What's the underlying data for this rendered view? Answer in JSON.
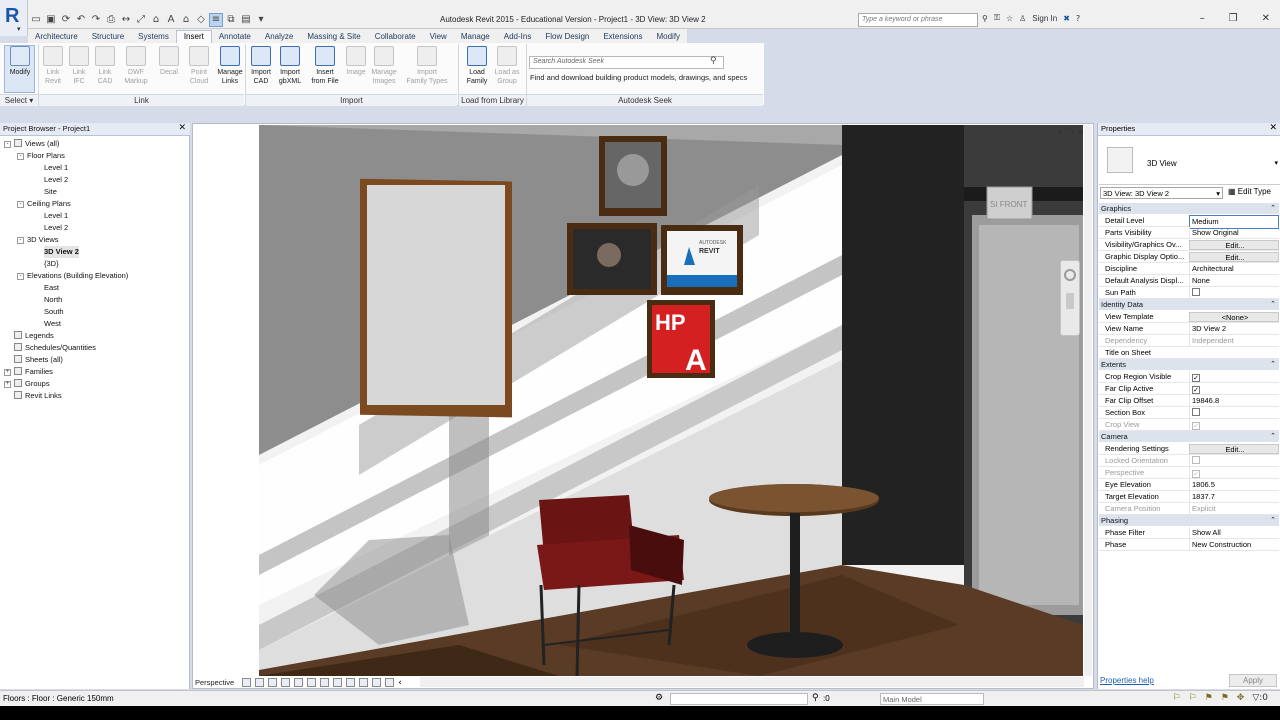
{
  "title_bar": {
    "title": "Autodesk Revit 2015 - Educational Version -    Project1 - 3D View: 3D View 2",
    "search_placeholder": "Type a keyword or phrase",
    "sign_in": "Sign In",
    "app_letter": "R"
  },
  "ribbon": {
    "tabs": [
      "Architecture",
      "Structure",
      "Systems",
      "Insert",
      "Annotate",
      "Analyze",
      "Massing & Site",
      "Collaborate",
      "View",
      "Manage",
      "Add-Ins",
      "Flow Design",
      "Extensions",
      "Modify"
    ],
    "active_tab": "Insert",
    "modify": "Modify",
    "select": "Select",
    "link_buttons": [
      {
        "line1": "Link",
        "line2": "Revit"
      },
      {
        "line1": "Link",
        "line2": "IFC"
      },
      {
        "line1": "Link",
        "line2": "CAD"
      },
      {
        "line1": "DWF",
        "line2": "Markup"
      },
      {
        "line1": "Decal",
        "line2": ""
      },
      {
        "line1": "Point",
        "line2": "Cloud"
      },
      {
        "line1": "Manage",
        "line2": "Links"
      }
    ],
    "import_buttons": [
      {
        "line1": "Import",
        "line2": "CAD"
      },
      {
        "line1": "Import",
        "line2": "gbXML"
      },
      {
        "line1": "Insert",
        "line2": "from File"
      },
      {
        "line1": "Image",
        "line2": ""
      },
      {
        "line1": "Manage",
        "line2": "Images"
      },
      {
        "line1": "Import",
        "line2": "Family Types"
      }
    ],
    "library_buttons": [
      {
        "line1": "Load",
        "line2": "Family"
      },
      {
        "line1": "Load as",
        "line2": "Group"
      }
    ],
    "groups": {
      "link": "Link",
      "import": "Import",
      "library": "Load from Library",
      "seek": "Autodesk Seek"
    },
    "seek_placeholder": "Search Autodesk Seek",
    "seek_description": "Find and download building product models, drawings, and specs"
  },
  "project_browser": {
    "title": "Project Browser - Project1",
    "tree": [
      {
        "label": "Views (all)",
        "level": 0,
        "exp": "-"
      },
      {
        "label": "Floor Plans",
        "level": 1,
        "exp": "-"
      },
      {
        "label": "Level 1",
        "level": 2
      },
      {
        "label": "Level 2",
        "level": 2
      },
      {
        "label": "Site",
        "level": 2
      },
      {
        "label": "Ceiling Plans",
        "level": 1,
        "exp": "-"
      },
      {
        "label": "Level 1",
        "level": 2
      },
      {
        "label": "Level 2",
        "level": 2
      },
      {
        "label": "3D Views",
        "level": 1,
        "exp": "-"
      },
      {
        "label": "3D View 2",
        "level": 2,
        "selected": true
      },
      {
        "label": "{3D}",
        "level": 2
      },
      {
        "label": "Elevations (Building Elevation)",
        "level": 1,
        "exp": "-"
      },
      {
        "label": "East",
        "level": 2
      },
      {
        "label": "North",
        "level": 2
      },
      {
        "label": "South",
        "level": 2
      },
      {
        "label": "West",
        "level": 2
      },
      {
        "label": "Legends",
        "level": 0
      },
      {
        "label": "Schedules/Quantities",
        "level": 0
      },
      {
        "label": "Sheets (all)",
        "level": 0
      },
      {
        "label": "Families",
        "level": 0,
        "exp": "+"
      },
      {
        "label": "Groups",
        "level": 0,
        "exp": "+"
      },
      {
        "label": "Revit Links",
        "level": 0
      }
    ]
  },
  "viewport": {
    "scale_label": "Perspective",
    "poster_revit": "REVIT",
    "poster_autodesk": "AUTODESK",
    "poster_hp": "HP",
    "poster_a": "A",
    "sign_text": "SI FRONT"
  },
  "properties": {
    "title": "Properties",
    "type_name": "3D View",
    "instance": "3D View: 3D View 2",
    "edit_type": "Edit Type",
    "groups": [
      {
        "name": "Graphics",
        "rows": [
          {
            "k": "Detail Level",
            "v": "Medium",
            "style": "sel"
          },
          {
            "k": "Parts Visibility",
            "v": "Show Original"
          },
          {
            "k": "Visibility/Graphics Ov...",
            "v": "Edit...",
            "style": "btn"
          },
          {
            "k": "Graphic Display Optio...",
            "v": "Edit...",
            "style": "btn"
          },
          {
            "k": "Discipline",
            "v": "Architectural"
          },
          {
            "k": "Default Analysis Displ...",
            "v": "None"
          },
          {
            "k": "Sun Path",
            "v": "",
            "cb": "off"
          }
        ]
      },
      {
        "name": "Identity Data",
        "rows": [
          {
            "k": "View Template",
            "v": "<None>",
            "style": "btn"
          },
          {
            "k": "View Name",
            "v": "3D View 2"
          },
          {
            "k": "Dependency",
            "v": "Independent",
            "dim": true
          },
          {
            "k": "Title on Sheet",
            "v": ""
          }
        ]
      },
      {
        "name": "Extents",
        "rows": [
          {
            "k": "Crop Region Visible",
            "v": "",
            "cb": "on"
          },
          {
            "k": "Far Clip Active",
            "v": "",
            "cb": "on"
          },
          {
            "k": "Far Clip Offset",
            "v": "19846.8"
          },
          {
            "k": "Section Box",
            "v": "",
            "cb": "off"
          },
          {
            "k": "Crop View",
            "v": "",
            "cb": "dim",
            "dim": true
          }
        ]
      },
      {
        "name": "Camera",
        "rows": [
          {
            "k": "Rendering Settings",
            "v": "Edit...",
            "style": "btn"
          },
          {
            "k": "Locked Orientation",
            "v": "",
            "cb": "dimoff",
            "dim": true
          },
          {
            "k": "Perspective",
            "v": "",
            "cb": "dim",
            "dim": true
          },
          {
            "k": "Eye Elevation",
            "v": "1806.5"
          },
          {
            "k": "Target Elevation",
            "v": "1837.7"
          },
          {
            "k": "Camera Position",
            "v": "Explicit",
            "dim": true
          }
        ]
      },
      {
        "name": "Phasing",
        "rows": [
          {
            "k": "Phase Filter",
            "v": "Show All"
          },
          {
            "k": "Phase",
            "v": "New Construction"
          }
        ]
      }
    ],
    "help": "Properties help",
    "apply": "Apply"
  },
  "status_bar": {
    "text": "Floors : Floor : Generic 150mm",
    "zero": ":0",
    "model": "Main Model"
  }
}
